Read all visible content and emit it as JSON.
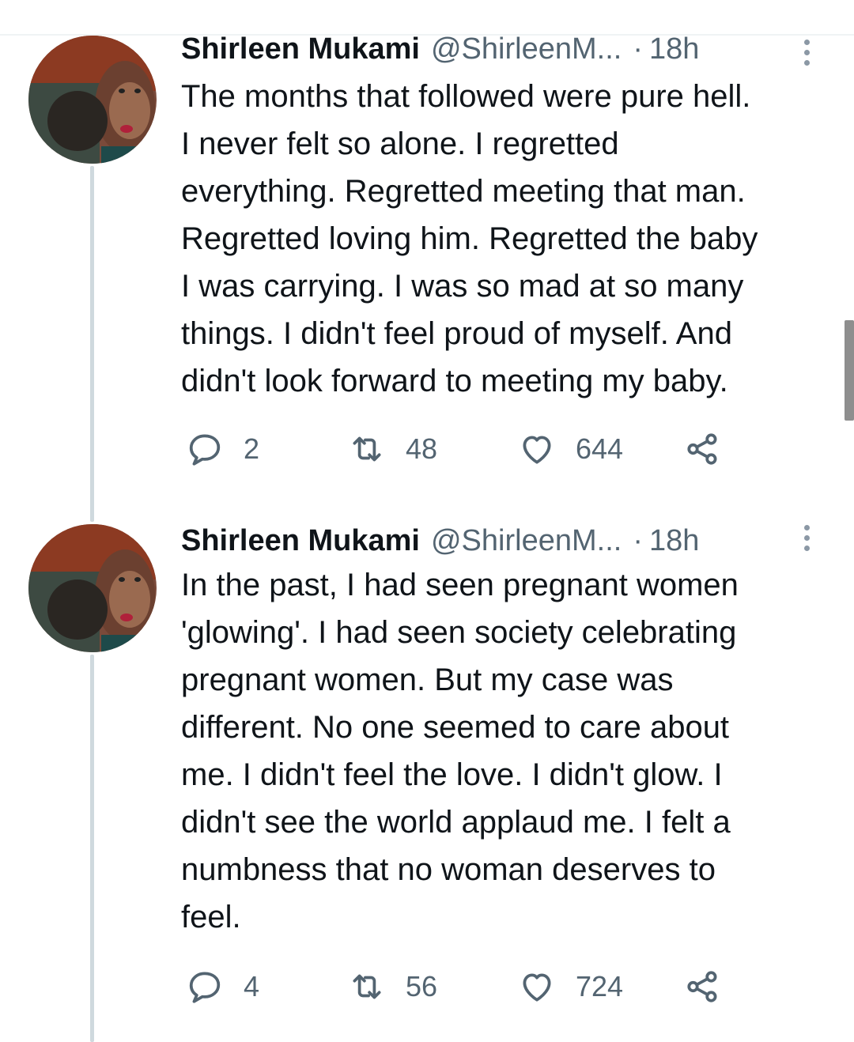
{
  "tweets": [
    {
      "display_name": "Shirleen Mukami",
      "handle": "@ShirleenM...",
      "separator": "·",
      "time": "18h",
      "lines": [
        "The months that followed were pure hell.",
        "I never felt so alone. I regretted",
        "everything. Regretted meeting that man.",
        "Regretted loving him. Regretted the baby",
        "I was carrying. I was so mad at so many",
        "things. I didn't feel proud of myself. And",
        "didn't look forward to meeting my baby."
      ],
      "replies": "2",
      "retweets": "48",
      "likes": "644"
    },
    {
      "display_name": "Shirleen Mukami",
      "handle": "@ShirleenM...",
      "separator": "·",
      "time": "18h",
      "lines": [
        "In the past, I had seen pregnant women",
        "'glowing'. I had seen society celebrating",
        "pregnant women. But my case was",
        "different. No one seemed to care about",
        "me. I didn't feel the love. I didn't glow. I",
        "didn't see the world applaud me. I felt a",
        "numbness that no woman deserves to",
        "feel."
      ],
      "replies": "4",
      "retweets": "56",
      "likes": "724"
    }
  ],
  "icons": {
    "reply": "reply-icon",
    "retweet": "retweet-icon",
    "like": "heart-icon",
    "share": "share-icon",
    "more": "more-vertical-icon"
  },
  "colors": {
    "text": "#0f1419",
    "secondary": "#536471",
    "thread_line": "#cfd9de"
  }
}
